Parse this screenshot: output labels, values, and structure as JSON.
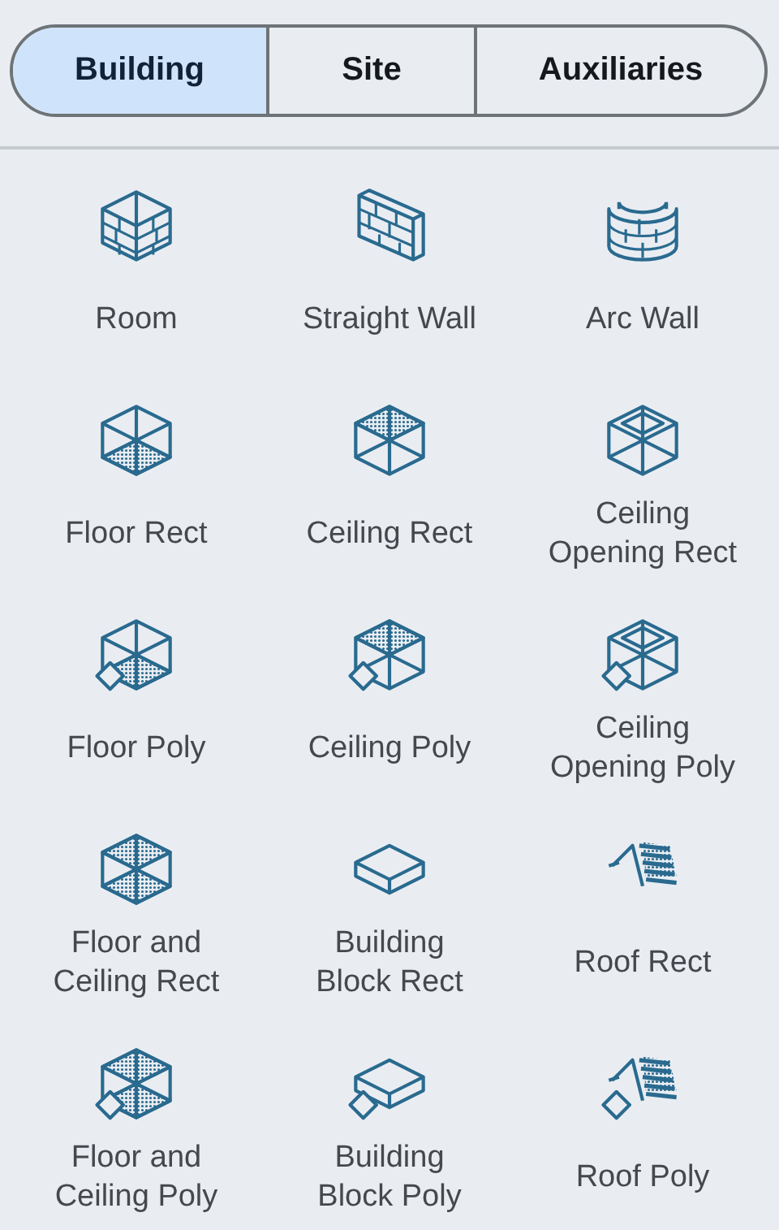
{
  "tabs": [
    {
      "label": "Building",
      "selected": true
    },
    {
      "label": "Site",
      "selected": false
    },
    {
      "label": "Auxiliaries",
      "selected": false
    }
  ],
  "tools": [
    {
      "label": "Room",
      "kind": "room",
      "poly": false
    },
    {
      "label": "Straight Wall",
      "kind": "wall",
      "poly": false
    },
    {
      "label": "Arc Wall",
      "kind": "arcwall",
      "poly": false
    },
    {
      "label": "Floor Rect",
      "kind": "floor",
      "poly": false
    },
    {
      "label": "Ceiling Rect",
      "kind": "ceiling",
      "poly": false
    },
    {
      "label": "Ceiling\nOpening Rect",
      "kind": "opening",
      "poly": false
    },
    {
      "label": "Floor Poly",
      "kind": "floor",
      "poly": true
    },
    {
      "label": "Ceiling Poly",
      "kind": "ceiling",
      "poly": true
    },
    {
      "label": "Ceiling\nOpening Poly",
      "kind": "opening",
      "poly": true
    },
    {
      "label": "Floor and\nCeiling Rect",
      "kind": "both",
      "poly": false
    },
    {
      "label": "Building\nBlock Rect",
      "kind": "block",
      "poly": false
    },
    {
      "label": "Roof Rect",
      "kind": "roof",
      "poly": false
    },
    {
      "label": "Floor and\nCeiling Poly",
      "kind": "both",
      "poly": true
    },
    {
      "label": "Building\nBlock Poly",
      "kind": "block",
      "poly": true
    },
    {
      "label": "Roof Poly",
      "kind": "roof",
      "poly": true
    }
  ]
}
